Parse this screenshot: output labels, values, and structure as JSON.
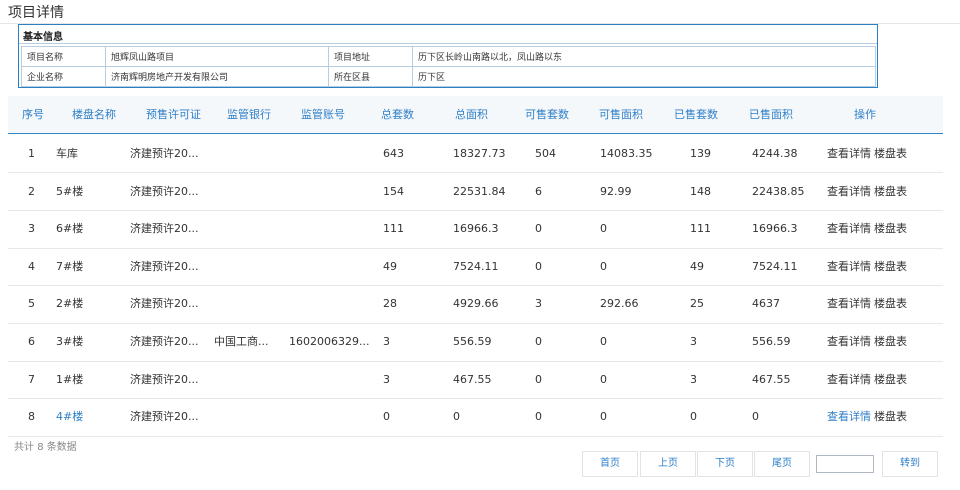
{
  "page": {
    "title": "项目详情"
  },
  "info": {
    "heading": "基本信息",
    "rows": [
      {
        "label1": "项目名称",
        "value1": "旭辉凤山路项目",
        "label2": "项目地址",
        "value2": "历下区长岭山南路以北，凤山路以东"
      },
      {
        "label1": "企业名称",
        "value1": "济南辉明房地产开发有限公司",
        "label2": "所在区县",
        "value2": "历下区"
      }
    ]
  },
  "table": {
    "columns": [
      "序号",
      "楼盘名称",
      "预售许可证",
      "监管银行",
      "监管账号",
      "总套数",
      "总面积",
      "可售套数",
      "可售面积",
      "已售套数",
      "已售面积",
      "操作"
    ],
    "op_detail": "查看详情",
    "op_plan": "楼盘表",
    "rows": [
      {
        "no": "1",
        "name": "车库",
        "permit": "济建预许20...",
        "bank": "",
        "account": "",
        "total_units": "643",
        "total_area": "18327.73",
        "avail_units": "504",
        "avail_area": "14083.35",
        "sold_units": "139",
        "sold_area": "4244.38"
      },
      {
        "no": "2",
        "name": "5#楼",
        "permit": "济建预许20...",
        "bank": "",
        "account": "",
        "total_units": "154",
        "total_area": "22531.84",
        "avail_units": "6",
        "avail_area": "92.99",
        "sold_units": "148",
        "sold_area": "22438.85"
      },
      {
        "no": "3",
        "name": "6#楼",
        "permit": "济建预许20...",
        "bank": "",
        "account": "",
        "total_units": "111",
        "total_area": "16966.3",
        "avail_units": "0",
        "avail_area": "0",
        "sold_units": "111",
        "sold_area": "16966.3"
      },
      {
        "no": "4",
        "name": "7#楼",
        "permit": "济建预许20...",
        "bank": "",
        "account": "",
        "total_units": "49",
        "total_area": "7524.11",
        "avail_units": "0",
        "avail_area": "0",
        "sold_units": "49",
        "sold_area": "7524.11"
      },
      {
        "no": "5",
        "name": "2#楼",
        "permit": "济建预许20...",
        "bank": "",
        "account": "",
        "total_units": "28",
        "total_area": "4929.66",
        "avail_units": "3",
        "avail_area": "292.66",
        "sold_units": "25",
        "sold_area": "4637"
      },
      {
        "no": "6",
        "name": "3#楼",
        "permit": "济建预许20...",
        "bank": "中国工商...",
        "account": "1602006329...",
        "total_units": "3",
        "total_area": "556.59",
        "avail_units": "0",
        "avail_area": "0",
        "sold_units": "3",
        "sold_area": "556.59"
      },
      {
        "no": "7",
        "name": "1#楼",
        "permit": "济建预许20...",
        "bank": "",
        "account": "",
        "total_units": "3",
        "total_area": "467.55",
        "avail_units": "0",
        "avail_area": "0",
        "sold_units": "3",
        "sold_area": "467.55"
      },
      {
        "no": "8",
        "name": "4#楼",
        "permit": "济建预许20...",
        "bank": "",
        "account": "",
        "total_units": "0",
        "total_area": "0",
        "avail_units": "0",
        "avail_area": "0",
        "sold_units": "0",
        "sold_area": "0"
      }
    ]
  },
  "footer": {
    "total_prefix": "共计",
    "total_count": "8",
    "total_suffix": "条数据"
  },
  "pager": {
    "first": "首页",
    "prev": "上页",
    "next": "下页",
    "last": "尾页",
    "jump_value": "",
    "go": "转到"
  }
}
